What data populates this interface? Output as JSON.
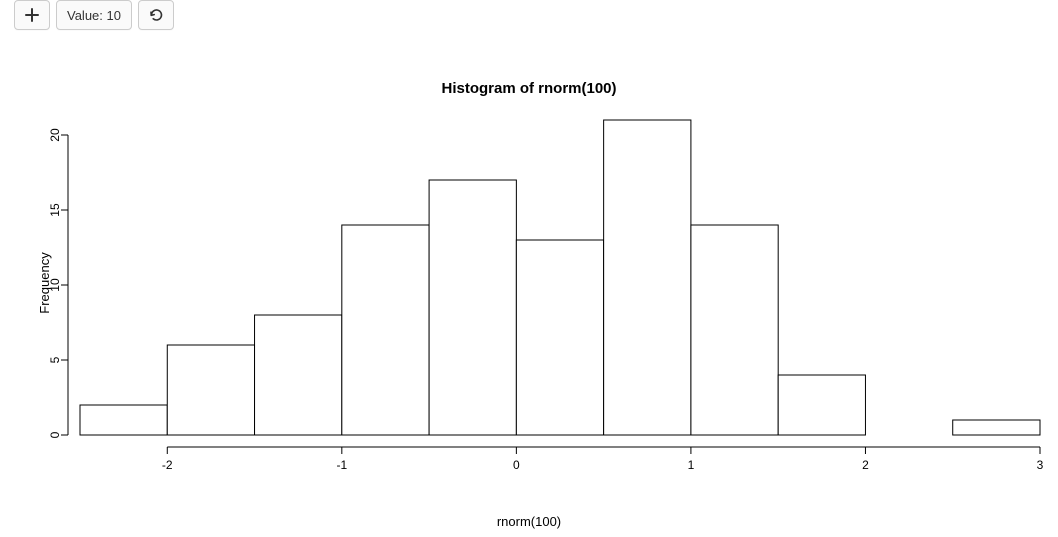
{
  "toolbar": {
    "value_label": "Value: 10"
  },
  "chart_data": {
    "type": "bar",
    "subtype": "histogram",
    "title": "Histogram of rnorm(100)",
    "xlabel": "rnorm(100)",
    "ylabel": "Frequency",
    "bin_edges": [
      -2.5,
      -2.0,
      -1.5,
      -1.0,
      -0.5,
      0.0,
      0.5,
      1.0,
      1.5,
      2.0,
      2.5,
      3.0
    ],
    "values": [
      2,
      6,
      8,
      14,
      17,
      13,
      21,
      14,
      4,
      0,
      1
    ],
    "xticks": [
      -2,
      -1,
      0,
      1,
      2,
      3
    ],
    "yticks": [
      0,
      5,
      10,
      15,
      20
    ],
    "xlim": [
      -2.5,
      3.0
    ],
    "ylim": [
      0,
      21
    ]
  }
}
